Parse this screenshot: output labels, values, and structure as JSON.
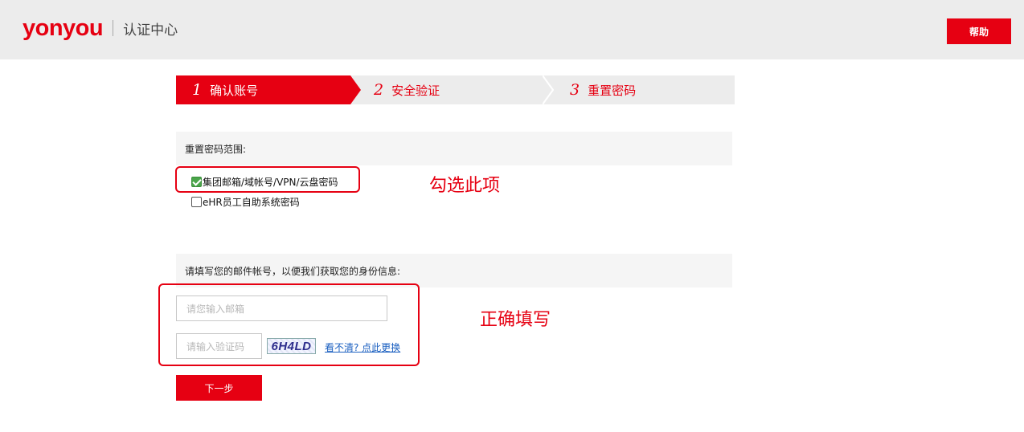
{
  "header": {
    "logo_text": "yonyou",
    "subtitle": "认证中心",
    "help_label": "帮助"
  },
  "steps": [
    {
      "num": "1",
      "label": "确认账号",
      "active": true
    },
    {
      "num": "2",
      "label": "安全验证",
      "active": false
    },
    {
      "num": "3",
      "label": "重置密码",
      "active": false
    }
  ],
  "scope": {
    "heading": "重置密码范围:",
    "options": [
      {
        "label": "集团邮箱/域帐号/VPN/云盘密码",
        "checked": true
      },
      {
        "label": "eHR员工自助系统密码",
        "checked": false
      }
    ]
  },
  "account": {
    "heading": "请填写您的邮件帐号，以便我们获取您的身份信息:",
    "email_placeholder": "请您输入邮箱",
    "code_placeholder": "请输入验证码",
    "captcha_text": "6H4LD",
    "refresh_label": "看不清? 点此更换"
  },
  "annotations": {
    "check_hint": "勾选此项",
    "fill_hint": "正确填写"
  },
  "next_label": "下一步",
  "colors": {
    "brand_red": "#e60012",
    "header_bg": "#ececec",
    "link_blue": "#1a5fc0"
  }
}
